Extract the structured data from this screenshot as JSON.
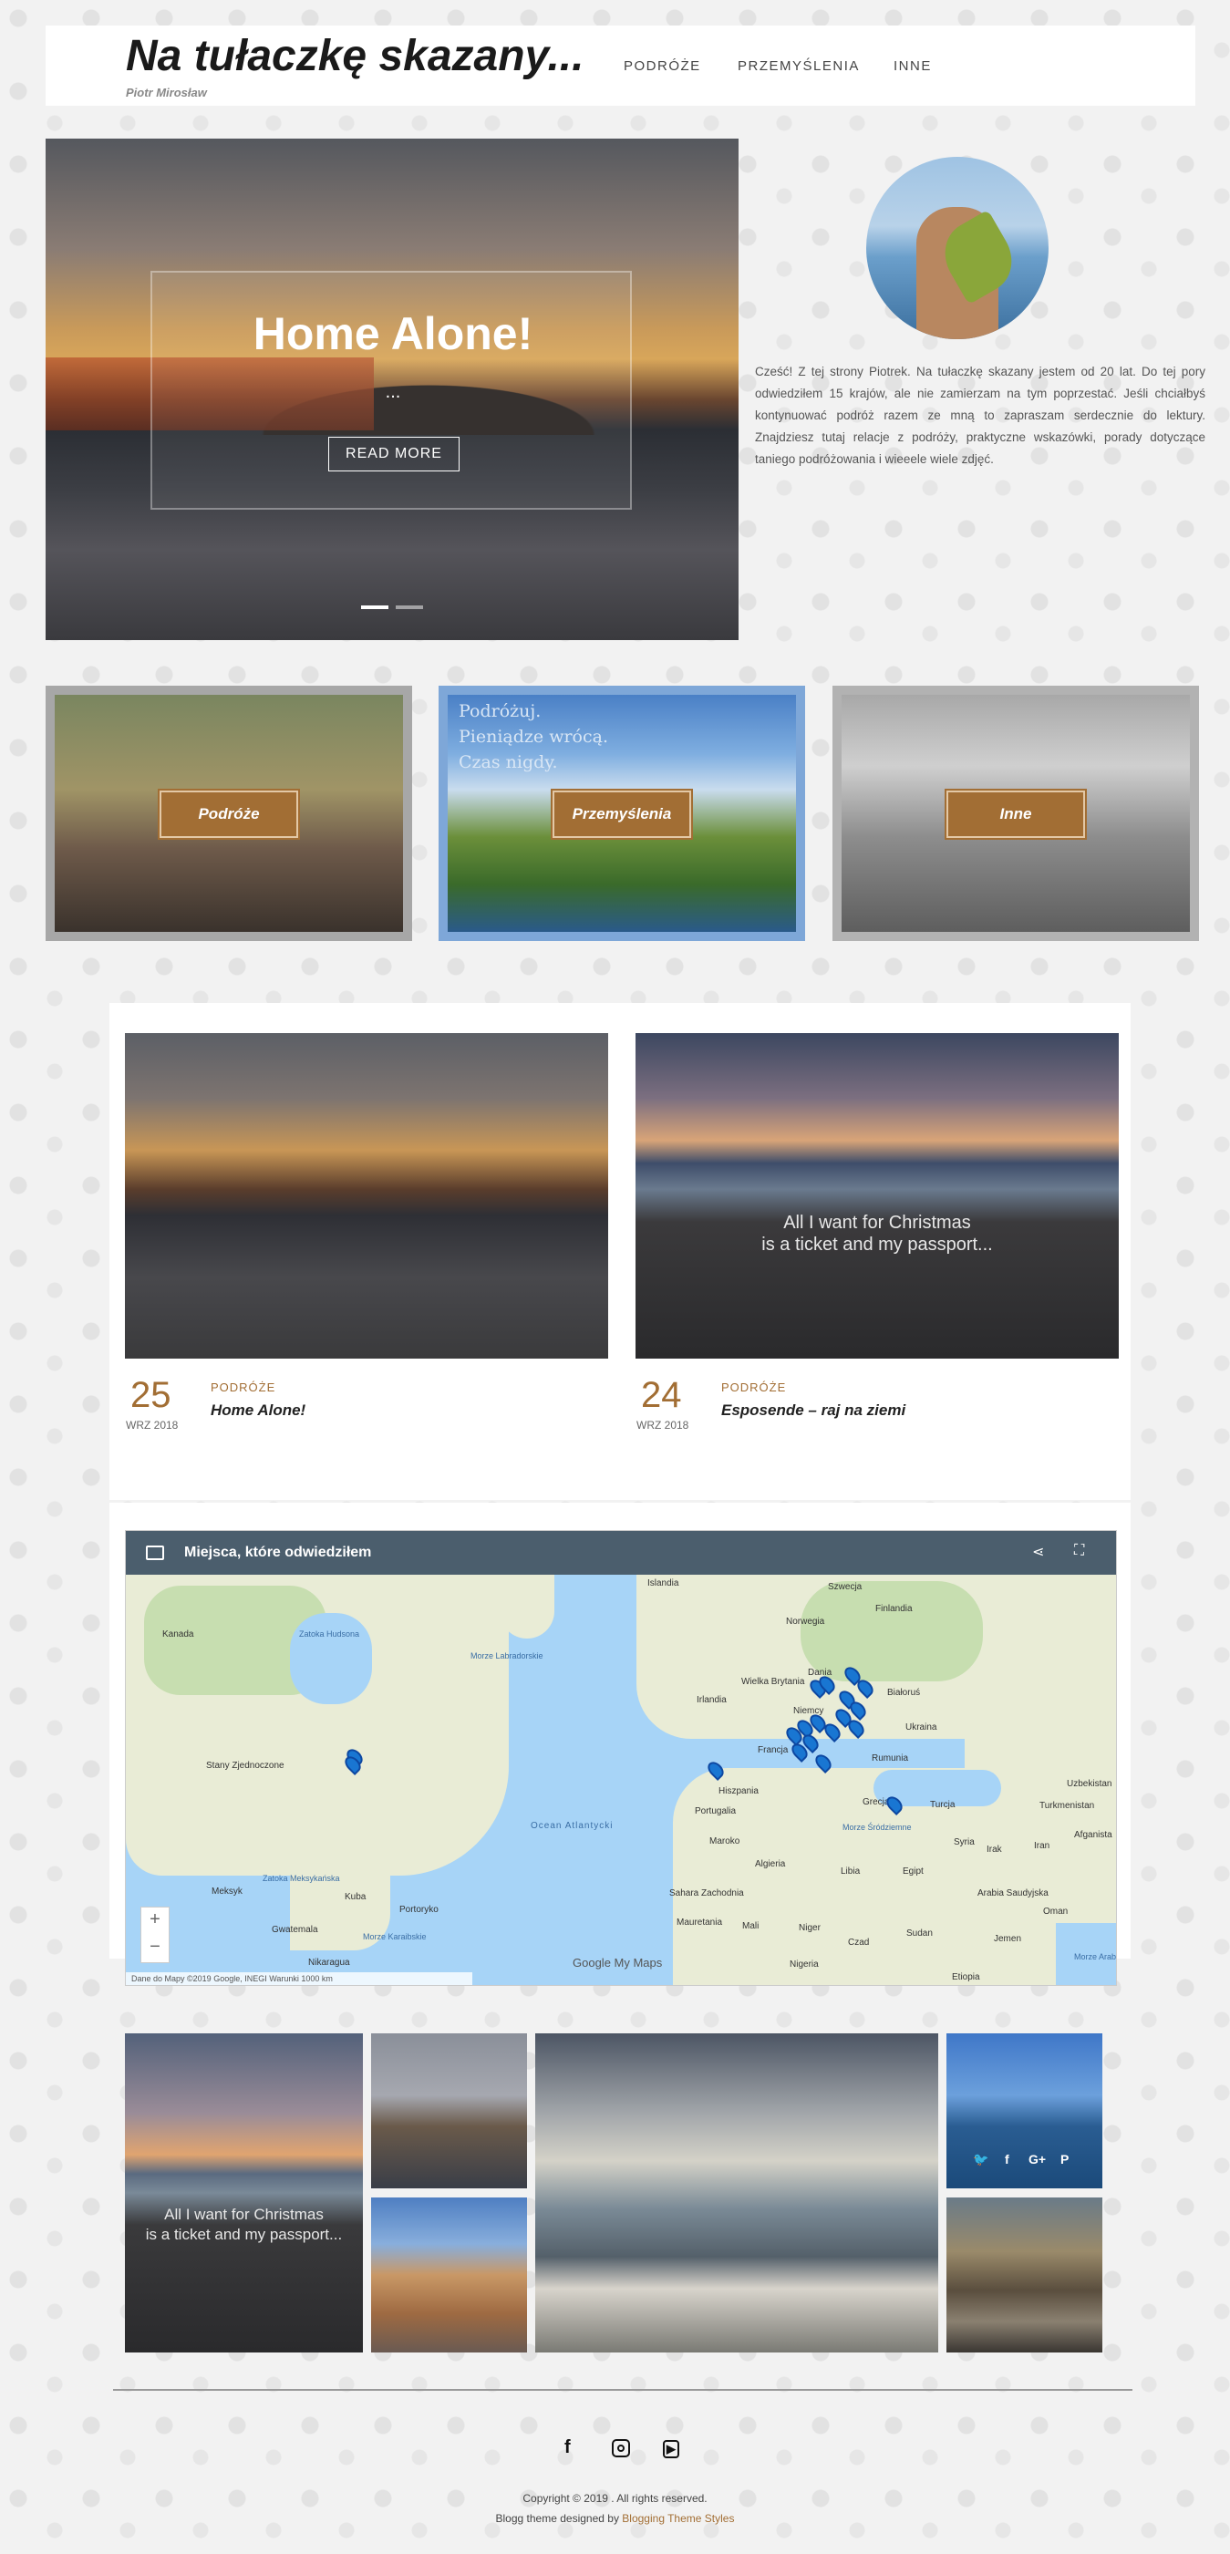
{
  "header": {
    "title": "Na tułaczkę skazany...",
    "subtitle": "Piotr Mirosław",
    "nav": [
      "PODRÓŻE",
      "PRZEMYŚLENIA",
      "INNE"
    ]
  },
  "hero": {
    "title": "Home Alone!",
    "excerpt": "...",
    "button": "READ MORE"
  },
  "about": {
    "text": "Cześć! Z tej strony Piotrek. Na tułaczkę skazany jestem od 20 lat. Do tej pory odwiedziłem 15 krajów, ale nie zamierzam na tym poprzestać. Jeśli chciałbyś kontynuować podróż razem ze mną to zapraszam serdecznie do lektury. Znajdziesz tutaj relacje z podróży, praktyczne wskazówki, porady dotyczące taniego podróżowania i wieeele wiele zdjęć."
  },
  "categories": [
    {
      "label": "Podróże"
    },
    {
      "label": "Przemyślenia",
      "caption": [
        "Podróżuj.",
        "Pieniądze wrócą.",
        "Czas nigdy."
      ]
    },
    {
      "label": "Inne"
    }
  ],
  "posts": [
    {
      "day": "25",
      "month": "WRZ 2018",
      "category": "PODRÓŻE",
      "title": "Home Alone!"
    },
    {
      "day": "24",
      "month": "WRZ 2018",
      "category": "PODRÓŻE",
      "title": "Esposende – raj na ziemi",
      "overlay": [
        "All I want for Christmas",
        "is a ticket and my passport..."
      ]
    }
  ],
  "map": {
    "title": "Miejsca, które odwiedziłem",
    "labels": {
      "islandia": "Islandia",
      "szwecja": "Szwecja",
      "finlandia": "Finlandia",
      "norwegia": "Norwegia",
      "kanada": "Kanada",
      "zatoka_hudsona": "Zatoka Hudsona",
      "morze_labradorskie": "Morze Labradorskie",
      "wielka_brytania": "Wielka Brytania",
      "irlandia": "Irlandia",
      "dania": "Dania",
      "bialorus": "Białoruś",
      "niemcy": "Niemcy",
      "ukraina": "Ukraina",
      "francja": "Francja",
      "rumunia": "Rumunia",
      "hiszpania": "Hiszpania",
      "portugalia": "Portugalia",
      "grecja": "Grecja",
      "turcja": "Turcja",
      "stany": "Stany Zjednoczone",
      "ocean": "Ocean Atlantycki",
      "maroko": "Maroko",
      "algieria": "Algieria",
      "libia": "Libia",
      "egipt": "Egipt",
      "syria": "Syria",
      "irak": "Irak",
      "iran": "Iran",
      "meksyk": "Meksyk",
      "zatoka_meksykanska": "Zatoka Meksykańska",
      "kuba": "Kuba",
      "sahara": "Sahara Zachodnia",
      "mauretania": "Mauretania",
      "mali": "Mali",
      "niger": "Niger",
      "czad": "Czad",
      "sudan": "Sudan",
      "nigeria": "Nigeria",
      "etiopia": "Etiopia",
      "jemen": "Jemen",
      "arabia": "Arabia Saudyjska",
      "oman": "Oman",
      "uzbekistan": "Uzbekistan",
      "turkmenistan": "Turkmenistan",
      "afganistan": "Afganista",
      "gwatemala": "Gwatemala",
      "morze_karaibskie": "Morze Karaibskie",
      "nikaragua": "Nikaragua",
      "portoryko": "Portoryko",
      "morze_srodziemne": "Morze Śródziemne",
      "morze_arabskie": "Morze Arabskie"
    },
    "attribution": "Dane do Mapy ©2019 Google, INEGI   Warunki   1000 km",
    "google_brand": "Google My Maps"
  },
  "gallery": {
    "overlay": [
      "All I want for Christmas",
      "is a ticket and my passport..."
    ],
    "social": [
      "twitter-icon",
      "facebook-icon",
      "google-plus-icon",
      "pinterest-icon"
    ]
  },
  "footer": {
    "copyright": "Copyright © 2019 . All rights reserved.",
    "credit_prefix": "Blogg theme designed by ",
    "credit_link": "Blogging Theme Styles",
    "icons": [
      "facebook-icon",
      "instagram-icon",
      "youtube-icon"
    ]
  },
  "colors": {
    "accent": "#a26e34",
    "map_bar": "#4b5e6d",
    "pin": "#1976d2"
  }
}
